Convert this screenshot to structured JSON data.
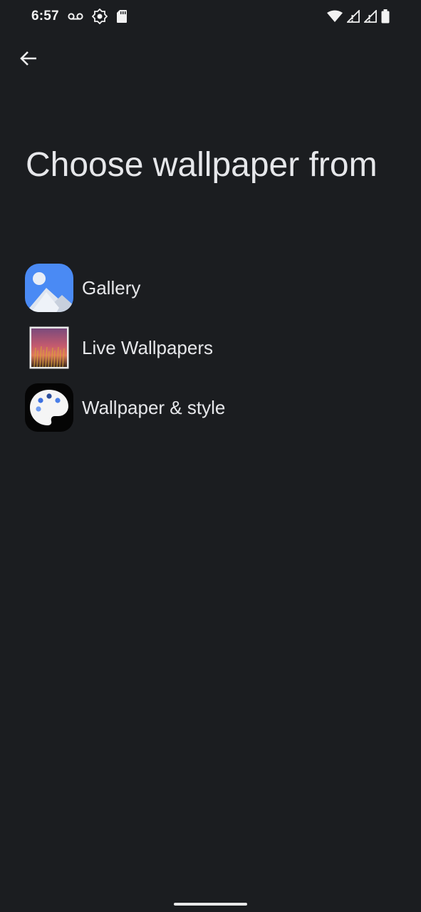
{
  "status_bar": {
    "time": "6:57",
    "left_icons": [
      "voicemail-icon",
      "brightness-icon",
      "sd-card-icon"
    ],
    "right_icons": [
      "wifi-icon",
      "signal-alert-icon",
      "signal-alert-icon",
      "battery-icon"
    ]
  },
  "header": {
    "back_icon": "arrow-back-icon"
  },
  "page": {
    "title": "Choose wallpaper from"
  },
  "options": [
    {
      "label": "Gallery",
      "icon": "gallery-icon"
    },
    {
      "label": "Live Wallpapers",
      "icon": "live-wallpapers-icon"
    },
    {
      "label": "Wallpaper & style",
      "icon": "palette-icon"
    }
  ],
  "colors": {
    "background": "#1b1d20",
    "text": "#e6e7ea",
    "gallery_blue": "#4285f4"
  }
}
